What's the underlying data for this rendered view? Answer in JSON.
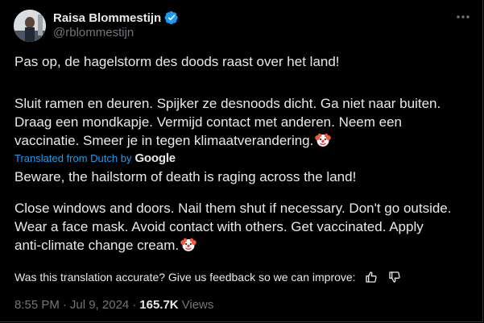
{
  "author": {
    "display_name": "Raisa Blommestijn",
    "handle": "@rblommestijn",
    "verified_icon": "verified-badge-icon",
    "avatar_icon": "avatar"
  },
  "tweet": {
    "original_line_1": "Pas op, de hagelstorm des doods raast over het land!",
    "original_line_2": "Sluit ramen en deuren. Spijker ze desnoods dicht. Ga niet naar buiten.",
    "original_line_3": "Draag een mondkapje. Vermijd contact met anderen. Neem een",
    "original_line_4": "vaccinatie. Smeer je in tegen klimaatverandering.",
    "translated_label": "Translated from Dutch by",
    "translation_provider": "Google",
    "translated_line_1": "Beware, the hailstorm of death is raging across the land!",
    "translated_line_2": "Close windows and doors. Nail them shut if necessary. Don't go outside.",
    "translated_line_3": "Wear a face mask. Avoid contact with others. Get vaccinated. Apply",
    "translated_line_4": "anti-climate change cream.",
    "emoji": "clown-face-icon"
  },
  "feedback": {
    "prompt": "Was this translation accurate? Give us feedback so we can improve:",
    "thumbs_up_icon": "thumbs-up-icon",
    "thumbs_down_icon": "thumbs-down-icon"
  },
  "meta": {
    "time": "8:55 PM",
    "separator": "·",
    "date": "Jul 9, 2024",
    "views_count": "165.7K",
    "views_label": "Views"
  },
  "colors": {
    "background": "#000000",
    "text": "#e7e9ea",
    "secondary": "#71767b",
    "accent": "#1d9bf0"
  }
}
